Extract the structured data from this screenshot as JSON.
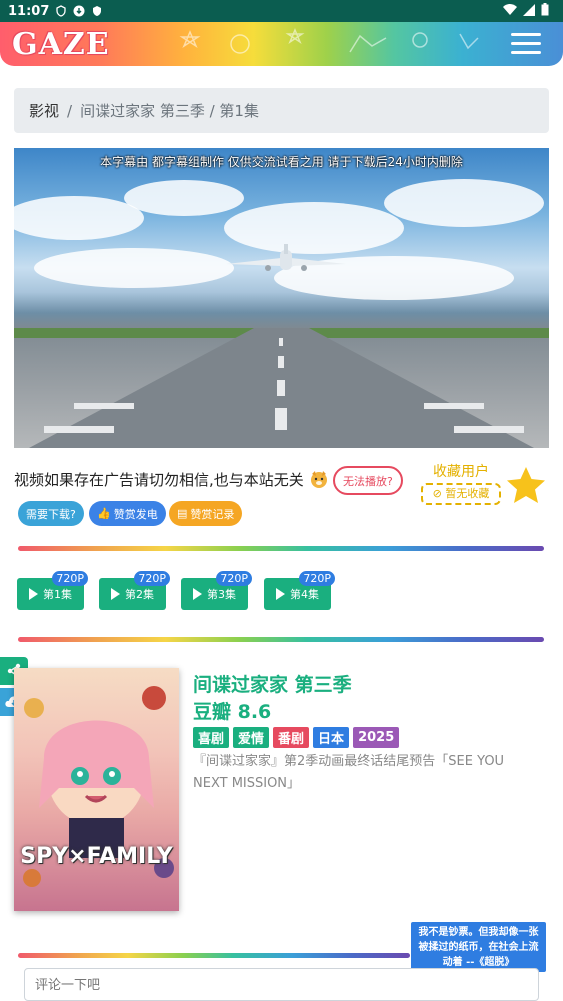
{
  "status_bar": {
    "time": "11:07"
  },
  "header": {
    "logo": "GAZE"
  },
  "breadcrumb": {
    "home": "影视",
    "separator": "/",
    "current": "间谍过家家 第三季 / 第1集"
  },
  "video": {
    "subtitle": "本字幕由 都字幕组制作 仅供交流试看之用 请于下载后24小时内删除"
  },
  "info": {
    "notice": "视频如果存在广告请切勿相信,也与本站无关",
    "cant_play": "无法播放?",
    "fav_title": "收藏用户",
    "fav_none": "暂无收藏"
  },
  "buttons": {
    "download": "需要下载?",
    "sponsor": "赞赏发电",
    "record": "赞赏记录"
  },
  "episodes": [
    {
      "label": "第1集",
      "quality": "720P"
    },
    {
      "label": "第2集",
      "quality": "720P"
    },
    {
      "label": "第3集",
      "quality": "720P"
    },
    {
      "label": "第4集",
      "quality": "720P"
    }
  ],
  "detail": {
    "title": "间谍过家家 第三季",
    "rating": "豆瓣 8.6",
    "tags": [
      {
        "text": "喜剧",
        "color": "#1aaf7f"
      },
      {
        "text": "爱情",
        "color": "#1aaf7f"
      },
      {
        "text": "番剧",
        "color": "#e64a5f"
      },
      {
        "text": "日本",
        "color": "#2f7de1"
      },
      {
        "text": "2025",
        "color": "#9b59b6"
      }
    ],
    "description": "『间谍过家家』第2季动画最终话结尾预告「SEE YOU NEXT MISSION」",
    "poster_text": "SPY×FAMILY"
  },
  "quote": "我不是钞票。但我却像一张被揉过的纸币，在社会上流动着 --《超脱》",
  "comment": {
    "placeholder": "评论一下吧"
  }
}
